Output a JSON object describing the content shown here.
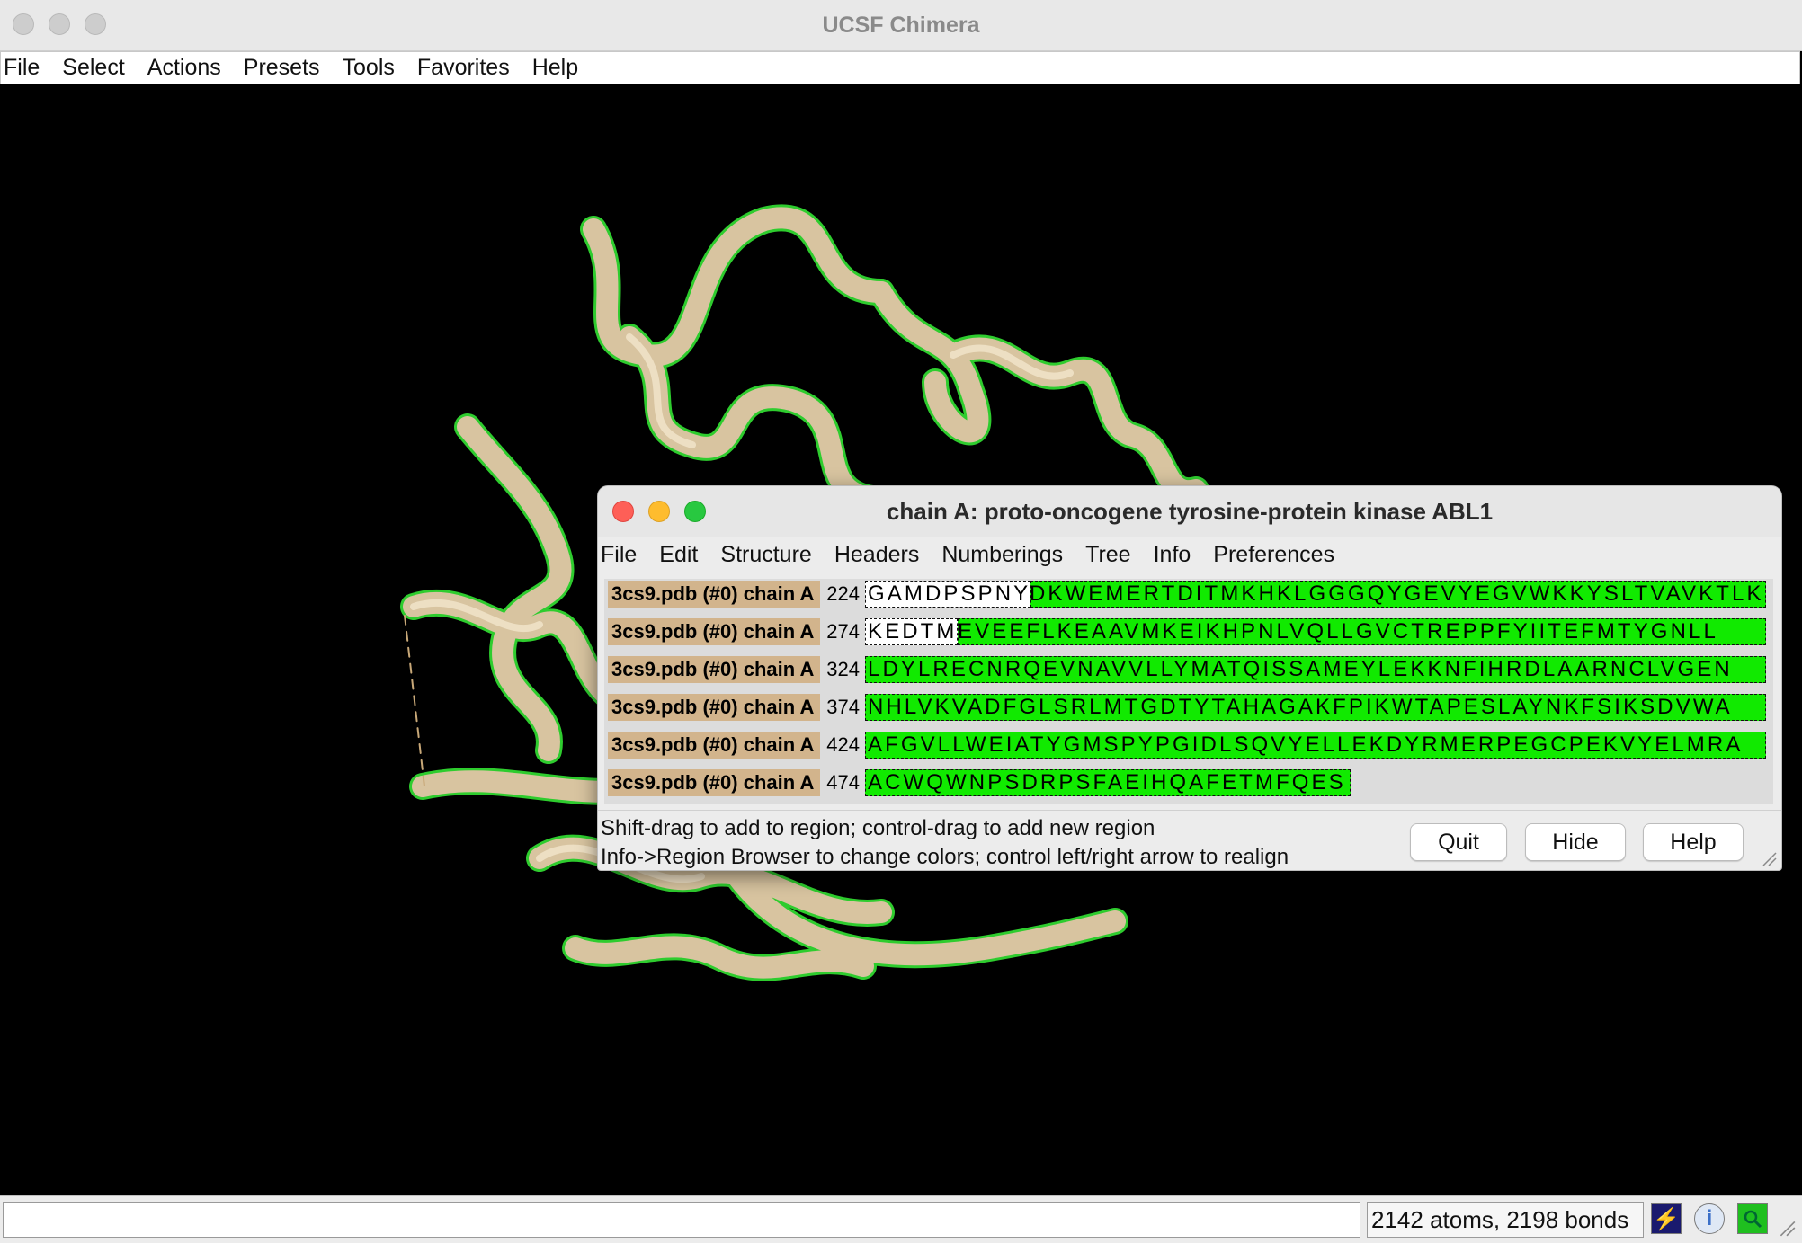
{
  "app": {
    "title": "UCSF Chimera",
    "menu": [
      "File",
      "Select",
      "Actions",
      "Presets",
      "Tools",
      "Favorites",
      "Help"
    ]
  },
  "status": {
    "command_value": "",
    "stats": "2142 atoms, 2198 bonds",
    "icons": [
      "lightning-icon",
      "info-icon",
      "magnifier-icon"
    ]
  },
  "colors": {
    "ribbon": "#d8c4a0",
    "selection_outline": "#2ecc2e",
    "structure_label_bg": "#d2b48c",
    "sequence_highlight": "#11ea00"
  },
  "dialog": {
    "title": "chain A: proto-oncogene tyrosine-protein kinase ABL1",
    "menu": [
      "File",
      "Edit",
      "Structure",
      "Headers",
      "Numberings",
      "Tree",
      "Info",
      "Preferences"
    ],
    "rows": [
      {
        "label": "3cs9.pdb (#0) chain A",
        "start": "224",
        "white": "GAMDPSPNY",
        "green": "DKWEMERTDITMKHKLGGGQYGEVYEGVWKKYSLTVAVKTLK"
      },
      {
        "label": "3cs9.pdb (#0) chain A",
        "start": "274",
        "white": "KEDTM",
        "green": "EVEEFLKEAAVMKEIKHPNLVQLLGVCTREPPFYIITEFMTYGNLL"
      },
      {
        "label": "3cs9.pdb (#0) chain A",
        "start": "324",
        "white": "",
        "green": "LDYLRECNRQEVNAVVLLYMATQISSAMEYLEKKNFIHRDLAARNCLVGEN"
      },
      {
        "label": "3cs9.pdb (#0) chain A",
        "start": "374",
        "white": "",
        "green": "NHLVKVADFGLSRLMTGDTYTAHAGAKFPIKWTAPESLAYNKFSIKSDVWA"
      },
      {
        "label": "3cs9.pdb (#0) chain A",
        "start": "424",
        "white": "",
        "green": "AFGVLLWEIATYGMSPYPGIDLSQVYELLEKDYRMERPEGCPEKVYELMRA"
      },
      {
        "label": "3cs9.pdb (#0) chain A",
        "start": "474",
        "white": "",
        "green": "ACWQWNPSDRPSFAEIHQAFETMFQES"
      }
    ],
    "hint_line1": "Shift-drag to add to region; control-drag to add new region",
    "hint_line2": "Info->Region Browser to change colors; control left/right arrow to realign",
    "buttons": {
      "quit": "Quit",
      "hide": "Hide",
      "help": "Help"
    }
  }
}
